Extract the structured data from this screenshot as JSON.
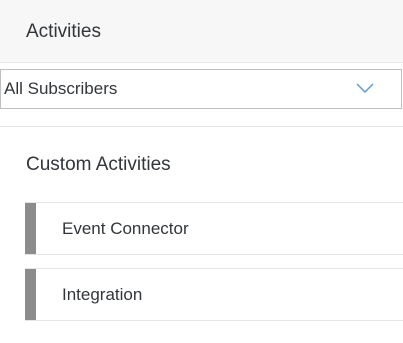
{
  "panel": {
    "title": "Activities"
  },
  "filter": {
    "selected": "All Subscribers",
    "icon": "chevron-down-icon"
  },
  "section": {
    "title": "Custom Activities",
    "items": [
      {
        "label": "Event Connector"
      },
      {
        "label": "Integration"
      }
    ]
  },
  "colors": {
    "header_bg": "#f7f7f7",
    "handle": "#8c8c8c",
    "chevron": "#5b9bd5",
    "text": "#32363a"
  }
}
